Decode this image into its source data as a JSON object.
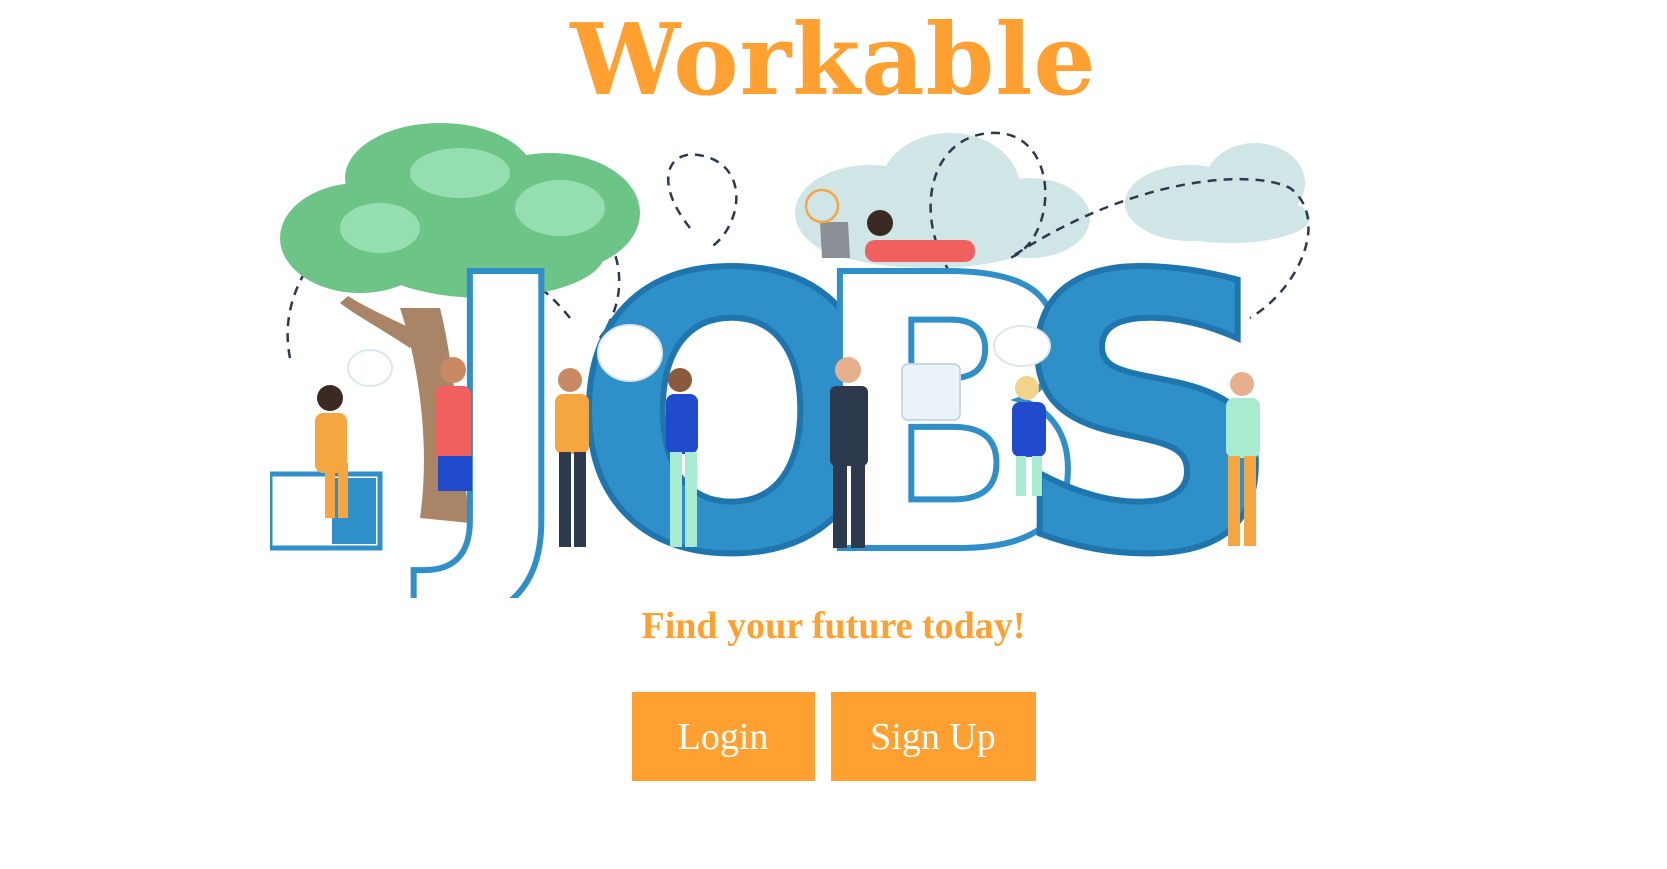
{
  "brand": {
    "title": "Workable"
  },
  "hero": {
    "letters": [
      "J",
      "O",
      "B",
      "S"
    ]
  },
  "tagline": "Find your future today!",
  "actions": {
    "login_label": "Login",
    "signup_label": "Sign Up"
  },
  "colors": {
    "accent": "#FFA030",
    "jobs_blue": "#2F8FC8",
    "tree_green": "#6CC487",
    "cloud": "#CFE5E6"
  }
}
